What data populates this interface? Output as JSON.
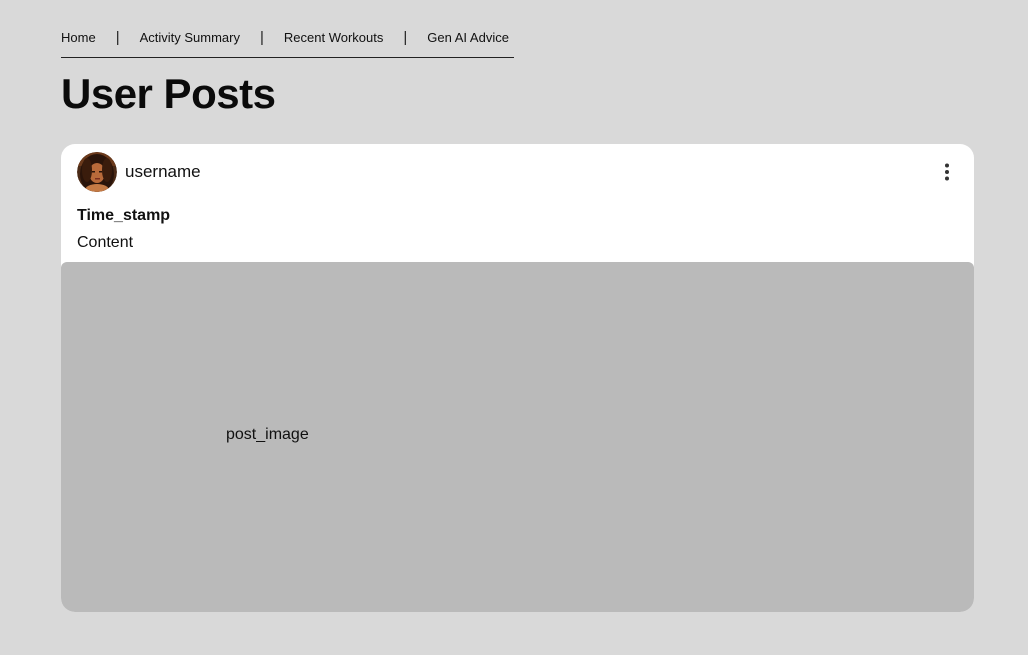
{
  "nav": {
    "links": [
      "Home",
      "Activity Summary",
      "Recent Workouts",
      "Gen AI Advice"
    ],
    "separator": "|"
  },
  "page": {
    "title": "User Posts"
  },
  "post": {
    "username": "username",
    "timestamp": "Time_stamp",
    "content": "Content",
    "image_label": "post_image",
    "avatar_icon": "user-avatar-photo",
    "menu_icon": "more-vertical-icon"
  },
  "colors": {
    "page_background": "#d9d9d9",
    "card_background": "#ffffff",
    "image_placeholder": "#bababa"
  }
}
